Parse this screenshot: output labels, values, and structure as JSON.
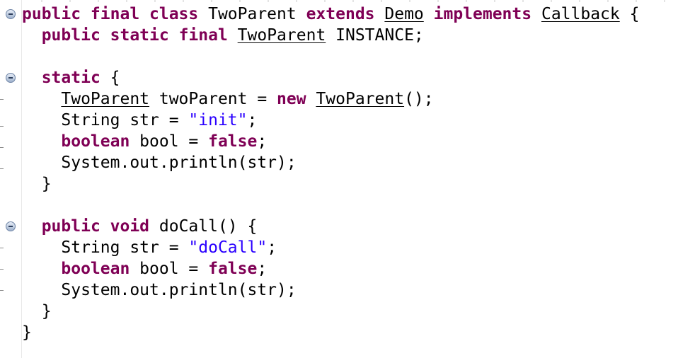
{
  "editor": {
    "lines": [
      [
        {
          "t": "public final class",
          "c": "kw"
        },
        {
          "t": " TwoParent ",
          "c": ""
        },
        {
          "t": "extends",
          "c": "kw"
        },
        {
          "t": " ",
          "c": ""
        },
        {
          "t": "Demo",
          "c": "ul"
        },
        {
          "t": " ",
          "c": ""
        },
        {
          "t": "implements",
          "c": "kw"
        },
        {
          "t": " ",
          "c": ""
        },
        {
          "t": "Callback",
          "c": "ul"
        },
        {
          "t": " {",
          "c": ""
        }
      ],
      [
        {
          "t": "  ",
          "c": ""
        },
        {
          "t": "public static final",
          "c": "kw"
        },
        {
          "t": " ",
          "c": ""
        },
        {
          "t": "TwoParent",
          "c": "ul"
        },
        {
          "t": " INSTANCE;",
          "c": ""
        }
      ],
      [],
      [
        {
          "t": "  ",
          "c": ""
        },
        {
          "t": "static",
          "c": "kw"
        },
        {
          "t": " {",
          "c": ""
        }
      ],
      [
        {
          "t": "    ",
          "c": ""
        },
        {
          "t": "TwoParent",
          "c": "ul"
        },
        {
          "t": " twoParent = ",
          "c": ""
        },
        {
          "t": "new",
          "c": "kw"
        },
        {
          "t": " ",
          "c": ""
        },
        {
          "t": "TwoParent",
          "c": "ul"
        },
        {
          "t": "();",
          "c": ""
        }
      ],
      [
        {
          "t": "    String str = ",
          "c": ""
        },
        {
          "t": "\"init\"",
          "c": "str"
        },
        {
          "t": ";",
          "c": ""
        }
      ],
      [
        {
          "t": "    ",
          "c": ""
        },
        {
          "t": "boolean",
          "c": "kw"
        },
        {
          "t": " bool = ",
          "c": ""
        },
        {
          "t": "false",
          "c": "kw"
        },
        {
          "t": ";",
          "c": ""
        }
      ],
      [
        {
          "t": "    System.out.println(str);",
          "c": ""
        }
      ],
      [
        {
          "t": "  }",
          "c": ""
        }
      ],
      [],
      [
        {
          "t": "  ",
          "c": ""
        },
        {
          "t": "public void",
          "c": "kw"
        },
        {
          "t": " doCall() {",
          "c": ""
        }
      ],
      [
        {
          "t": "    String str = ",
          "c": ""
        },
        {
          "t": "\"doCall\"",
          "c": "str"
        },
        {
          "t": ";",
          "c": ""
        }
      ],
      [
        {
          "t": "    ",
          "c": ""
        },
        {
          "t": "boolean",
          "c": "kw"
        },
        {
          "t": " bool = ",
          "c": ""
        },
        {
          "t": "false",
          "c": "kw"
        },
        {
          "t": ";",
          "c": ""
        }
      ],
      [
        {
          "t": "    System.out.println(str);",
          "c": ""
        }
      ],
      [
        {
          "t": "  }",
          "c": ""
        }
      ],
      [
        {
          "t": "}",
          "c": ""
        }
      ]
    ],
    "fold_icons": [
      "collapse-icon",
      "collapse-icon",
      "collapse-icon"
    ],
    "colors": {
      "keyword": "#7f0055",
      "string": "#2a00ff",
      "text": "#000000",
      "background": "#ffffff"
    }
  }
}
